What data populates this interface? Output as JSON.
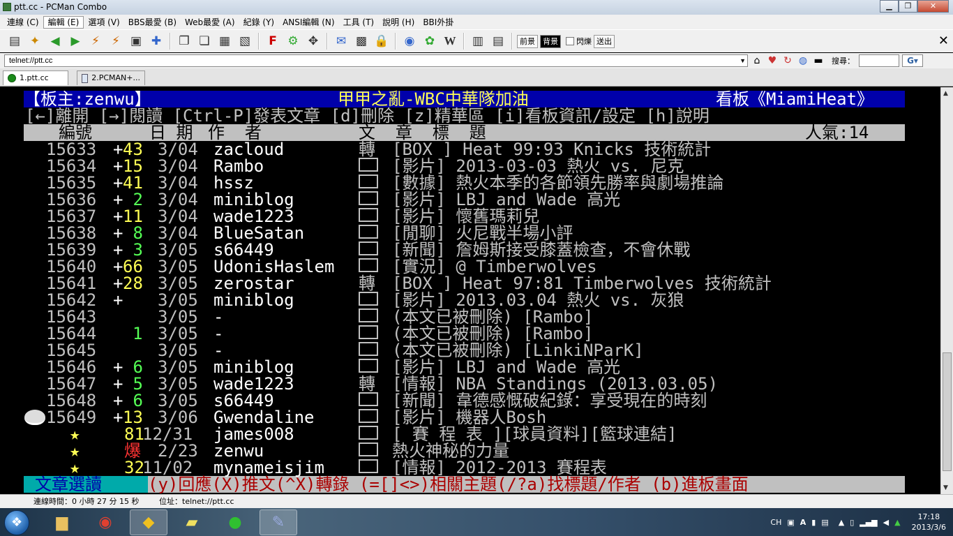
{
  "window": {
    "title": "ptt.cc - PCMan Combo",
    "btn_min": "▁",
    "btn_max": "❐",
    "btn_close": "✕"
  },
  "menu": [
    "連線 (C)",
    "編輯 (E)",
    "選項 (V)",
    "BBS最愛 (B)",
    "Web最愛 (A)",
    "紀錄 (Y)",
    "ANSI編輯 (N)",
    "工具 (T)",
    "說明 (H)",
    "BBI外掛"
  ],
  "toolbar": {
    "prev_label": "前景",
    "bg_label": "背景",
    "blink_label": "閃爍",
    "send_label": "送出"
  },
  "address": {
    "value": "telnet://ptt.cc",
    "search_label": "搜尋："
  },
  "tabs": [
    {
      "label": "1.ptt.cc"
    },
    {
      "label": "2.PCMAN+..."
    }
  ],
  "board": {
    "header_left": "【板主:zenwu】",
    "header_mid": "甲甲之亂-WBC中華隊加油",
    "header_right": "看板《MiamiHeat》",
    "help": "[←]離開 [→]閱讀 [Ctrl-P]發表文章 [d]刪除 [z]精華區 [i]看板資訊/設定 [h]說明",
    "col_num": "編號",
    "col_date": "日 期",
    "col_author": "作  者",
    "col_title": "文  章  標  題",
    "popularity": "人氣:14",
    "footer_mode": "文章選讀",
    "footer_help": "(y)回應(X)推文(^X)轉錄 (=[]<>)相關主題(/?a)找標題/作者 (b)進板畫面"
  },
  "posts": [
    {
      "num": "15633",
      "push": "+43",
      "date": "3/04",
      "author": "zacloud",
      "mark": "轉",
      "title": "[BOX ] Heat 99:93 Knicks 技術統計"
    },
    {
      "num": "15634",
      "push": "+15",
      "date": "3/04",
      "author": "Rambo",
      "mark": "□",
      "title": "[影片] 2013-03-03 熱火 vs. 尼克"
    },
    {
      "num": "15635",
      "push": "+41",
      "date": "3/04",
      "author": "hssz",
      "mark": "□",
      "title": "[數據] 熱火本季的各節領先勝率與劇場推論"
    },
    {
      "num": "15636",
      "push": "+ 2",
      "date": "3/04",
      "author": "miniblog",
      "mark": "□",
      "title": "[影片] LBJ and Wade 高光"
    },
    {
      "num": "15637",
      "push": "+11",
      "date": "3/04",
      "author": "wade1223",
      "mark": "□",
      "title": "[影片] 懷舊瑪莉兒"
    },
    {
      "num": "15638",
      "push": "+ 8",
      "date": "3/04",
      "author": "BlueSatan",
      "mark": "□",
      "title": "[閒聊] 火尼戰半場小評"
    },
    {
      "num": "15639",
      "push": "+ 3",
      "date": "3/05",
      "author": "s66449",
      "mark": "□",
      "title": "[新聞] 詹姆斯接受膝蓋檢查，不會休戰"
    },
    {
      "num": "15640",
      "push": "+66",
      "date": "3/05",
      "author": "UdonisHaslem",
      "mark": "□",
      "title": "[實況] @ Timberwolves"
    },
    {
      "num": "15641",
      "push": "+28",
      "date": "3/05",
      "author": "zerostar",
      "mark": "轉",
      "title": "[BOX ] Heat 97:81 Timberwolves 技術統計"
    },
    {
      "num": "15642",
      "push": "+",
      "date": "3/05",
      "author": "miniblog",
      "mark": "□",
      "title": "[影片] 2013.03.04 熱火 vs. 灰狼"
    },
    {
      "num": "15643",
      "push": "",
      "date": "3/05",
      "author": "-",
      "mark": "□",
      "title": "(本文已被刪除) [Rambo]"
    },
    {
      "num": "15644",
      "push": "1",
      "date": "3/05",
      "author": "-",
      "mark": "□",
      "title": "(本文已被刪除) [Rambo]"
    },
    {
      "num": "15645",
      "push": "",
      "date": "3/05",
      "author": "-",
      "mark": "□",
      "title": "(本文已被刪除) [LinkiNParK]"
    },
    {
      "num": "15646",
      "push": "+ 6",
      "date": "3/05",
      "author": "miniblog",
      "mark": "□",
      "title": "[影片] LBJ and Wade 高光"
    },
    {
      "num": "15647",
      "push": "+ 5",
      "date": "3/05",
      "author": "wade1223",
      "mark": "轉",
      "title": "[情報] NBA Standings (2013.03.05)"
    },
    {
      "num": "15648",
      "push": "+ 6",
      "date": "3/05",
      "author": "s66449",
      "mark": "□",
      "title": "[新聞] 韋德感慨破紀錄：享受現在的時刻"
    },
    {
      "num": "15649",
      "push": "+13",
      "date": "3/06",
      "author": "Gwendaline",
      "mark": "□",
      "title": "[影片] 機器人Bosh"
    }
  ],
  "pinned": [
    {
      "star": "★",
      "push": "81",
      "date": "12/31",
      "author": "james008",
      "mark": "□",
      "title": "[ 賽 程 表 ][球員資料][籃球連結]"
    },
    {
      "star": "★",
      "push": "爆",
      "date": "2/23",
      "author": "zenwu",
      "mark": "□",
      "title": "熱火神秘的力量"
    },
    {
      "star": "★",
      "push": "32",
      "date": "11/02",
      "author": "mynameisjim",
      "mark": "□",
      "title": "[情報] 2012-2013 賽程表"
    }
  ],
  "status": {
    "conn_time": "連線時間：0 小時 27 分 15 秒",
    "addr": "位址：telnet://ptt.cc"
  },
  "taskbar": {
    "ime": "CH",
    "time": "17:18",
    "date": "2013/3/6"
  },
  "colors": {
    "term_bg": "#000000",
    "header_blue": "#0000aa",
    "push_yellow": "#ffff55",
    "push_green": "#55ff55",
    "push_red": "#ff3333",
    "footer_cyan": "#00aaaa"
  }
}
